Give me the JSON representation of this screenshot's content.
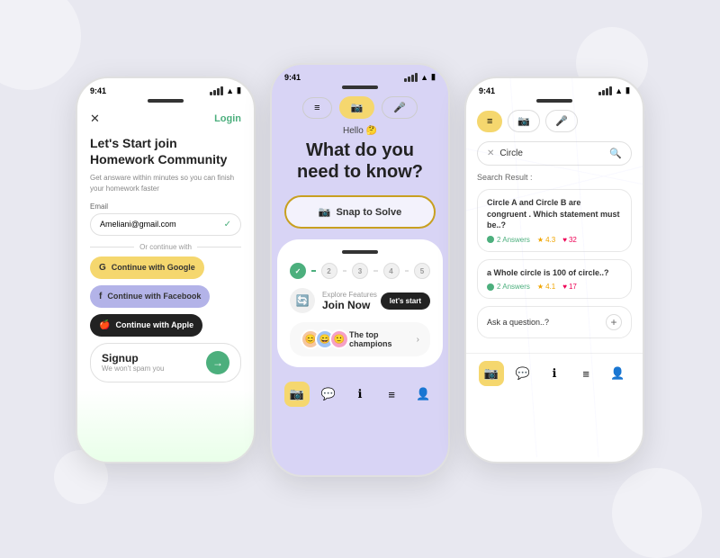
{
  "background": {
    "color": "#e8e8f0"
  },
  "phone1": {
    "status_time": "9:41",
    "close_icon": "✕",
    "login_label": "Login",
    "title": "Let's Start join",
    "title_bold": "Homework Community",
    "subtitle": "Get answare within minutes so you can finish your homework faster",
    "email_label": "Email",
    "email_value": "Ameliani@gmail.com",
    "divider_text": "Or continue with",
    "google_btn": "Continue with Google",
    "facebook_btn": "Continue with Facebook",
    "apple_btn": "Continue with Apple",
    "signup_title": "Signup",
    "signup_sub": "We won't spam you"
  },
  "phone2": {
    "status_time": "9:41",
    "hello_text": "Hello 🤔",
    "main_title": "What do you need to know?",
    "snap_btn": "Snap to Solve",
    "explore_label": "Explore Features",
    "join_label": "Join Now",
    "lets_start": "let's start",
    "champions_text": "The top champions",
    "steps": [
      "2",
      "3",
      "4",
      "5"
    ]
  },
  "phone3": {
    "status_time": "9:41",
    "search_value": "Circle",
    "results_label": "Search Result :",
    "result1": {
      "title": "Circle A and Circle B are congruent . Which statement must be..?",
      "answers": "2 Answers",
      "rating": "4.3",
      "likes": "32"
    },
    "result2": {
      "title": "a Whole circle is 100 of circle..?",
      "answers": "2 Answers",
      "rating": "4.1",
      "likes": "17"
    },
    "ask_label": "Ask a question..?"
  }
}
